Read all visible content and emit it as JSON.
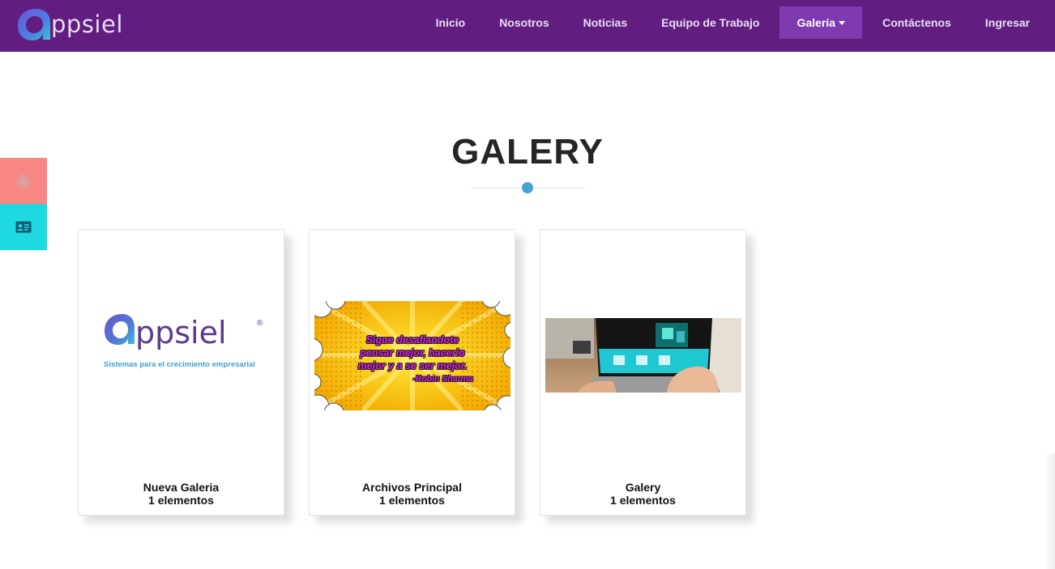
{
  "brand": {
    "name": "ppsiel",
    "icon": "appsiel-logo-a"
  },
  "nav": {
    "items": [
      {
        "label": "Inicio"
      },
      {
        "label": "Nosotros"
      },
      {
        "label": "Noticias"
      },
      {
        "label": "Equipo de Trabajo"
      },
      {
        "label": "Galería",
        "active": true,
        "dropdown": true
      },
      {
        "label": "Contáctenos"
      },
      {
        "label": "Ingresar"
      }
    ]
  },
  "side_buttons": [
    {
      "icon": "circle-icon",
      "color": "#f78783"
    },
    {
      "icon": "contact-card-icon",
      "color": "#1ed9e0"
    }
  ],
  "section": {
    "title": "GALERY",
    "accent_color": "#45a3d6"
  },
  "galleries": [
    {
      "name": "Nueva Galeria",
      "count": "1 elementos",
      "image": {
        "logo_text": "ppsiel",
        "registered": "®",
        "tagline": "Sistemas para el crecimiento empresarial"
      }
    },
    {
      "name": "Archivos Principal",
      "count": "1 elementos",
      "image": {
        "quote_lines": [
          "Sigue desafiandote",
          "pensar mejor, hacerlo",
          "mejor y a se ser mejor."
        ],
        "author": "-Robin Sharma"
      }
    },
    {
      "name": "Galery",
      "count": "1 elementos",
      "image": {
        "description_icon": "laptop-photo"
      }
    }
  ],
  "colors": {
    "navbar": "#611e80",
    "nav_active": "#7e3aae"
  }
}
